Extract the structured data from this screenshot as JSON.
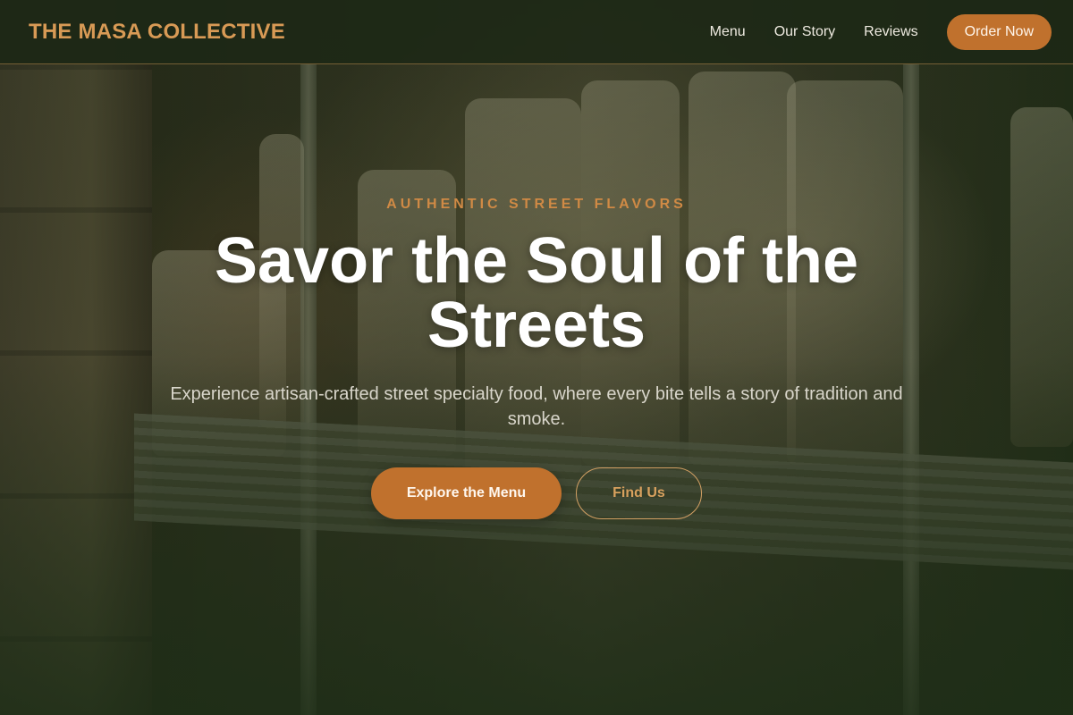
{
  "navbar": {
    "brand": "THE MASA COLLECTIVE",
    "links": [
      "Menu",
      "Our Story",
      "Reviews"
    ],
    "order_button": "Order Now"
  },
  "hero": {
    "eyebrow": "AUTHENTIC STREET FLAVORS",
    "headline": "Savor the Soul of the Streets",
    "subtitle": "Experience artisan-crafted street specialty food, where every bite tells a story of tradition and smoke.",
    "primary_button": "Explore the Menu",
    "secondary_button": "Find Us"
  },
  "colors": {
    "accent": "#c0712d",
    "brand_text": "#d89a55",
    "background": "#1f2a17"
  }
}
